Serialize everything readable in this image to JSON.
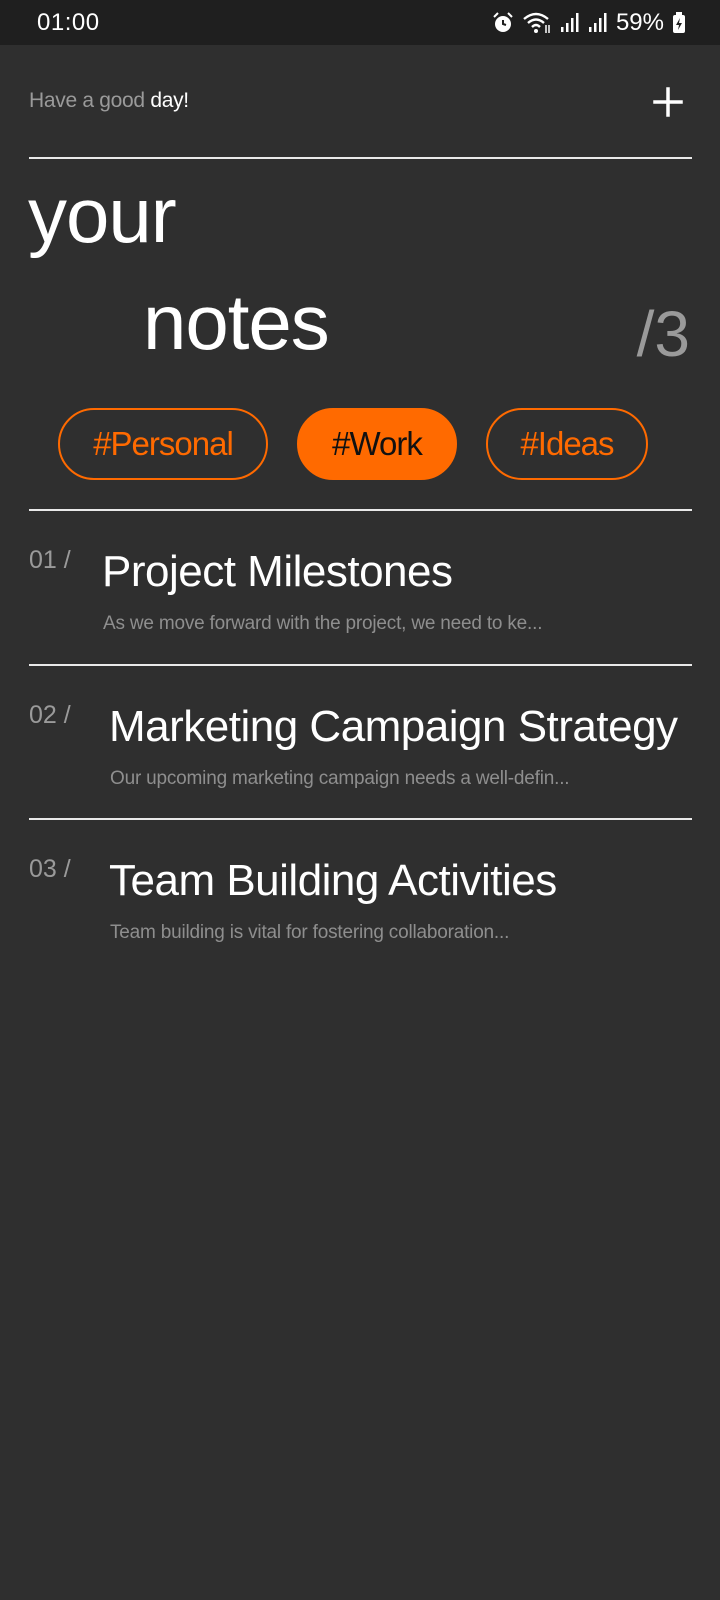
{
  "status_bar": {
    "time": "01:00",
    "battery": "59%",
    "icons": [
      "alarm-icon",
      "wifi-icon",
      "signal-icon",
      "signal-icon",
      "battery-charging-icon"
    ]
  },
  "header": {
    "greeting_prefix": "Have a good",
    "greeting_word": "day!",
    "add_icon": "plus-icon"
  },
  "title": {
    "line1": "your",
    "line2": "notes",
    "count": "/3"
  },
  "tags": [
    {
      "label": "#Personal",
      "active": false
    },
    {
      "label": "#Work",
      "active": true
    },
    {
      "label": "#Ideas",
      "active": false
    }
  ],
  "notes": [
    {
      "index": "01 /",
      "title": "Project Milestones",
      "preview": "As we move forward with the project, we need to ke..."
    },
    {
      "index": "02 /",
      "title": "Marketing Campaign Strategy",
      "preview": "Our upcoming marketing campaign needs a well-defin..."
    },
    {
      "index": "03 /",
      "title": "Team Building Activities",
      "preview": "Team building is vital for fostering collaboration..."
    }
  ],
  "colors": {
    "background": "#2f2f2f",
    "status_bar": "#1f1f1f",
    "accent": "#ff6a00",
    "muted_text": "#9a9a9a"
  }
}
